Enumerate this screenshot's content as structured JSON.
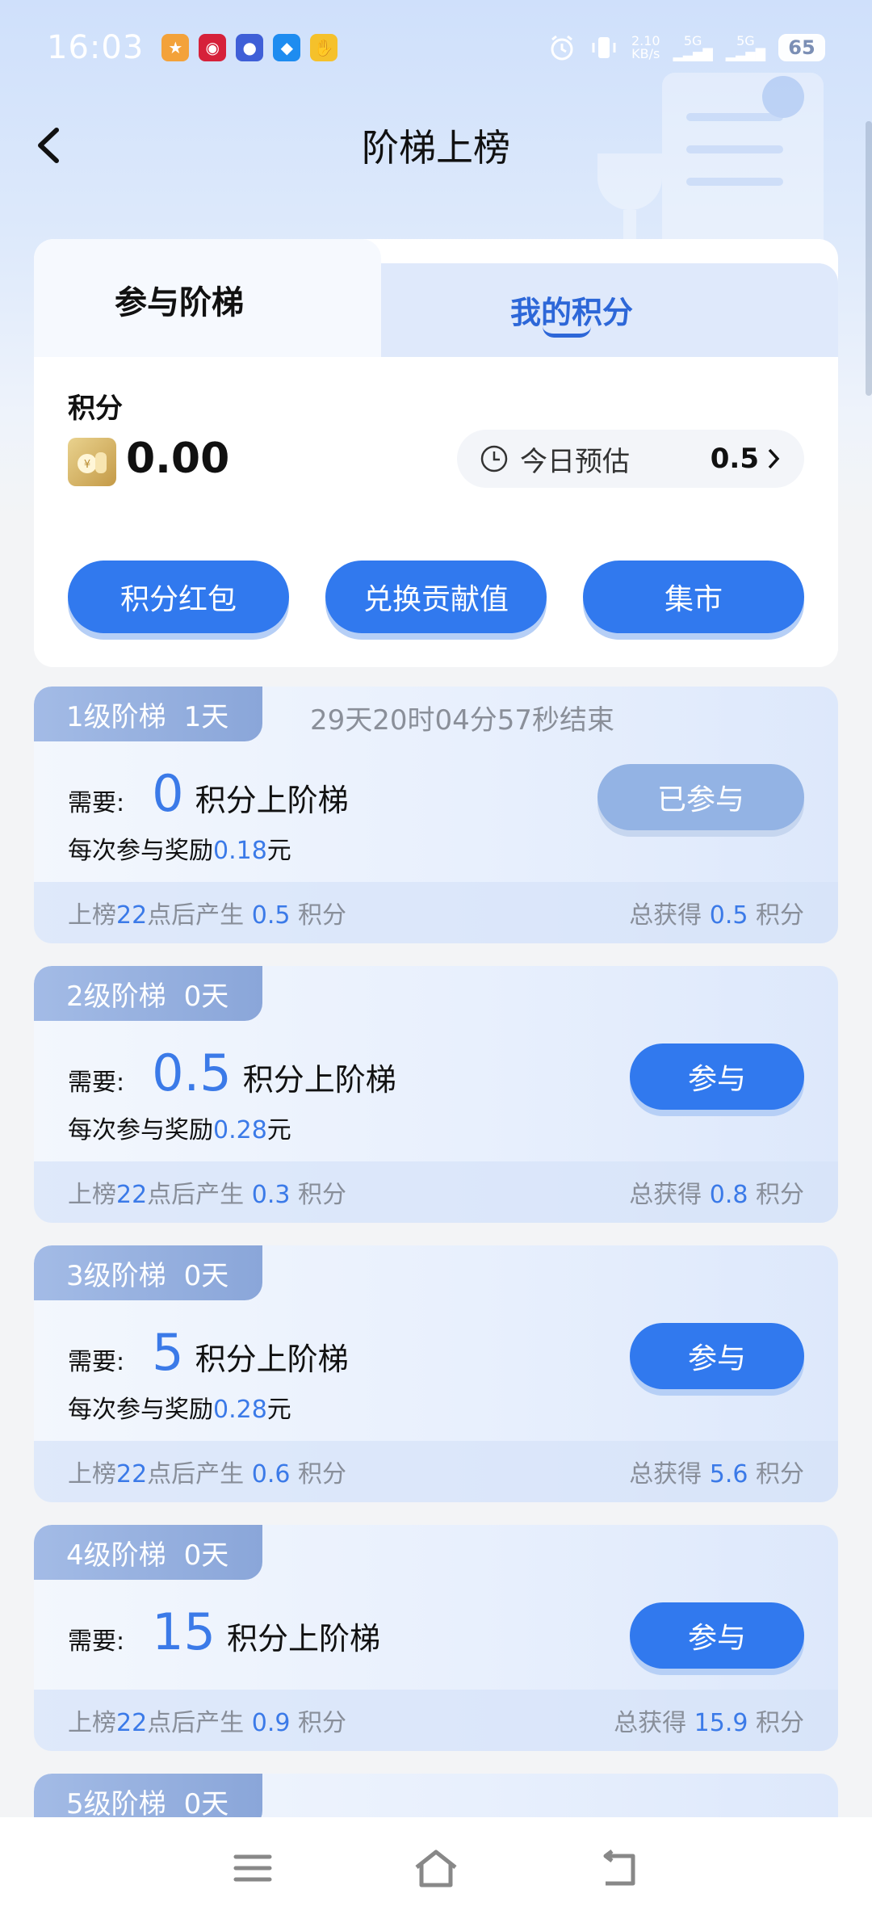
{
  "status_bar": {
    "time": "16:03",
    "net_speed_top": "2.10",
    "net_speed_bottom": "KB/s",
    "sig1": "5G",
    "sig2": "5G",
    "battery": "65",
    "notif_icons": [
      "police-app-icon",
      "bank-app-icon",
      "tieba-app-icon",
      "du-app-icon",
      "hand-app-icon"
    ]
  },
  "header": {
    "title": "阶梯上榜"
  },
  "tabs": {
    "active": "参与阶梯",
    "inactive": "我的积分"
  },
  "points": {
    "label": "积分",
    "value": "0.00",
    "estimate_label": "今日预估",
    "estimate_value": "0.5"
  },
  "actions": [
    "积分红包",
    "兑换贡献值",
    "集市"
  ],
  "tiers": [
    {
      "level": "1级阶梯",
      "days": "1天",
      "timer": "29天20时04分57秒结束",
      "need_label": "需要:",
      "need_value": "0",
      "need_suffix": "积分上阶梯",
      "reward_prefix": "每次参与奖励",
      "reward_value": "0.18",
      "reward_unit": "元",
      "button": "已参与",
      "footer_a": "上榜",
      "footer_hour": "22",
      "footer_b": "点后产生",
      "produce_value": "0.5",
      "produce_unit": "积分",
      "total_label": "总获得",
      "total_value": "0.5",
      "total_unit": "积分"
    },
    {
      "level": "2级阶梯",
      "days": "0天",
      "need_label": "需要:",
      "need_value": "0.5",
      "need_suffix": "积分上阶梯",
      "reward_prefix": "每次参与奖励",
      "reward_value": "0.28",
      "reward_unit": "元",
      "button": "参与",
      "footer_a": "上榜",
      "footer_hour": "22",
      "footer_b": "点后产生",
      "produce_value": "0.3",
      "produce_unit": "积分",
      "total_label": "总获得",
      "total_value": "0.8",
      "total_unit": "积分"
    },
    {
      "level": "3级阶梯",
      "days": "0天",
      "need_label": "需要:",
      "need_value": "5",
      "need_suffix": "积分上阶梯",
      "reward_prefix": "每次参与奖励",
      "reward_value": "0.28",
      "reward_unit": "元",
      "button": "参与",
      "footer_a": "上榜",
      "footer_hour": "22",
      "footer_b": "点后产生",
      "produce_value": "0.6",
      "produce_unit": "积分",
      "total_label": "总获得",
      "total_value": "5.6",
      "total_unit": "积分"
    },
    {
      "level": "4级阶梯",
      "days": "0天",
      "need_label": "需要:",
      "need_value": "15",
      "need_suffix": "积分上阶梯",
      "button": "参与",
      "footer_a": "上榜",
      "footer_hour": "22",
      "footer_b": "点后产生",
      "produce_value": "0.9",
      "produce_unit": "积分",
      "total_label": "总获得",
      "total_value": "15.9",
      "total_unit": "积分"
    },
    {
      "level": "5级阶梯",
      "days": "0天"
    }
  ],
  "nav": [
    "menu-icon",
    "home-icon",
    "back-nav-icon"
  ],
  "colors": {
    "accent": "#3179ee",
    "accent_light": "#93b3e4",
    "value_blue": "#3b7ae8"
  }
}
